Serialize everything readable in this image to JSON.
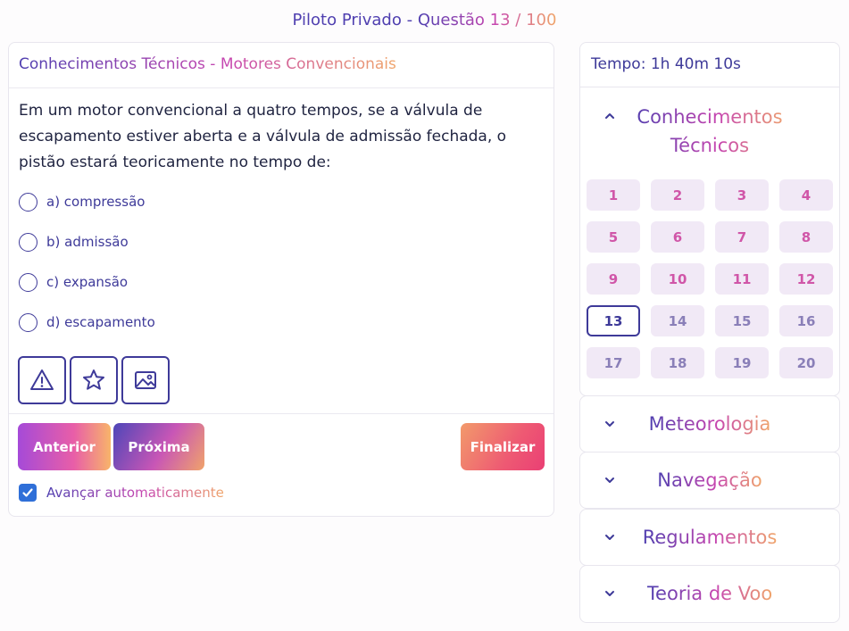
{
  "header": {
    "title_part1": "Piloto Privado - ",
    "title_part2": "Questão 13 / 100"
  },
  "question": {
    "category": "Conhecimentos Técnicos - Motores Convencionais",
    "text": "Em um motor convencional a quatro tempos, se a válvula de escapamento estiver aberta e a válvula de admissão fechada, o pistão estará teoricamente no tempo de:",
    "options": [
      {
        "label": "a) compressão"
      },
      {
        "label": "b) admissão"
      },
      {
        "label": "c) expansão"
      },
      {
        "label": "d) escapamento"
      }
    ],
    "tools": [
      {
        "icon": "warning-icon"
      },
      {
        "icon": "star-icon"
      },
      {
        "icon": "image-icon"
      }
    ]
  },
  "navigation": {
    "prev_label": "Anterior",
    "next_label": "Próxima",
    "finish_label": "Finalizar",
    "auto_advance_label": "Avançar automaticamente",
    "auto_advance_checked": true
  },
  "sidebar": {
    "timer": "Tempo: 1h 40m 10s",
    "open_section": {
      "title": "Conhecimentos Técnicos",
      "questions": [
        "1",
        "2",
        "3",
        "4",
        "5",
        "6",
        "7",
        "8",
        "9",
        "10",
        "11",
        "12",
        "13",
        "14",
        "15",
        "16",
        "17",
        "18",
        "19",
        "20"
      ],
      "current": "13"
    },
    "sections": [
      {
        "title": "Meteorologia"
      },
      {
        "title": "Navegação"
      },
      {
        "title": "Regulamentos"
      },
      {
        "title": "Teoria de Voo"
      }
    ]
  },
  "colors": {
    "primary": "#3e3a99",
    "accent_pink": "#d056a8",
    "accent_orange": "#f0a56a",
    "checkbox": "#2f6fd8"
  }
}
